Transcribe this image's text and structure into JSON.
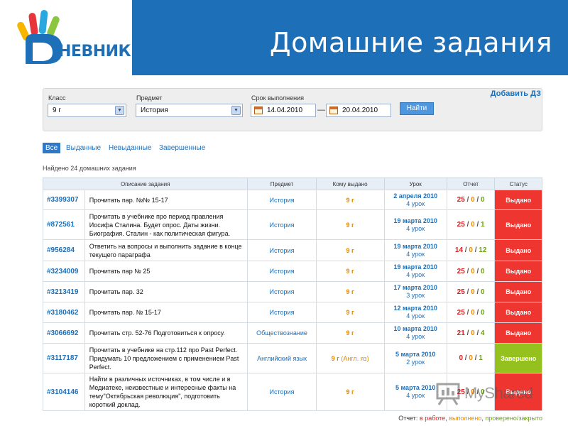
{
  "header": {
    "logo_text": "НЕВНИК",
    "title": "Домашние задания"
  },
  "filter": {
    "class_label": "Класс",
    "class_value": "9 г",
    "subject_label": "Предмет",
    "subject_value": "История",
    "deadline_label": "Срок выполнения",
    "date_from": "14.04.2010",
    "date_to": "20.04.2010",
    "dash": "—",
    "find_button": "Найти",
    "add_link": "Добавить ДЗ"
  },
  "tabs": [
    "Все",
    "Выданные",
    "Невыданные",
    "Завершенные"
  ],
  "found_text": "Найдено 24 домашних задания",
  "table": {
    "headers": [
      "Описание задания",
      "Предмет",
      "Кому выдано",
      "Урок",
      "Отчет",
      "Статус"
    ],
    "rows": [
      {
        "id": "#3399307",
        "desc": "Прочитать пар. №№ 15-17",
        "subject": "История",
        "to": "9 г",
        "to_note": "",
        "date": "2 апреля 2010",
        "lesson": "4 урок",
        "r1": "25",
        "r2": "0",
        "r3": "0",
        "status": "Выдано"
      },
      {
        "id": "#872561",
        "desc": "Прочитать в учебнике про период правления Иосифа Сталина. Будет опрос. Даты жизни. Биография. Сталин - как политическая фигура.",
        "subject": "История",
        "to": "9 г",
        "to_note": "",
        "date": "19 марта 2010",
        "lesson": "4 урок",
        "r1": "25",
        "r2": "0",
        "r3": "1",
        "status": "Выдано"
      },
      {
        "id": "#956284",
        "desc": "Ответить на вопросы и выполнить задание в конце текущего параграфа",
        "subject": "История",
        "to": "9 г",
        "to_note": "",
        "date": "19 марта 2010",
        "lesson": "4 урок",
        "r1": "14",
        "r2": "0",
        "r3": "12",
        "status": "Выдано"
      },
      {
        "id": "#3234009",
        "desc": "Прочитать пар № 25",
        "subject": "История",
        "to": "9 г",
        "to_note": "",
        "date": "19 марта 2010",
        "lesson": "4 урок",
        "r1": "25",
        "r2": "0",
        "r3": "0",
        "status": "Выдано"
      },
      {
        "id": "#3213419",
        "desc": "Прочитать пар. 32",
        "subject": "История",
        "to": "9 г",
        "to_note": "",
        "date": "17 марта 2010",
        "lesson": "3 урок",
        "r1": "25",
        "r2": "0",
        "r3": "0",
        "status": "Выдано"
      },
      {
        "id": "#3180462",
        "desc": "Прочитать пар. № 15-17",
        "subject": "История",
        "to": "9 г",
        "to_note": "",
        "date": "12 марта 2010",
        "lesson": "4 урок",
        "r1": "25",
        "r2": "0",
        "r3": "0",
        "status": "Выдано"
      },
      {
        "id": "#3066692",
        "desc": "Прочитать стр. 52-76 Подготовиться к опросу.",
        "subject": "Обществознание",
        "to": "9 г",
        "to_note": "",
        "date": "10 марта 2010",
        "lesson": "4 урок",
        "r1": "21",
        "r2": "0",
        "r3": "4",
        "status": "Выдано"
      },
      {
        "id": "#3117187",
        "desc": "Прочитать в учебнике на стр.112 про Past Perfect. Придумать 10 предложением с применением Past Perfect.",
        "subject": "Английский язык",
        "to": "9 г",
        "to_note": " (Англ. яз)",
        "date": "5 марта 2010",
        "lesson": "2 урок",
        "r1": "0",
        "r2": "0",
        "r3": "1",
        "status": "Завершено"
      },
      {
        "id": "#3104146",
        "desc": "Найти в различных источниках, в том числе и в Медиатеке, неизвестные и интересные факты на тему\"Октябрьская революция\", подготовить короткий доклад.",
        "subject": "История",
        "to": "9 г",
        "to_note": "",
        "date": "5 марта 2010",
        "lesson": "4 урок",
        "r1": "25",
        "r2": "0",
        "r3": "0",
        "status": "Выдано"
      }
    ]
  },
  "legend": {
    "prefix": "Отчет: ",
    "in_work": "в работе",
    "done": "выполнено",
    "checked": "проверено/закрыто"
  },
  "watermark": "MyShared",
  "colors": {
    "header_blue": "#1d6fb8",
    "issued_red": "#ef3530",
    "done_green": "#95c11f",
    "report_red": "#e02020",
    "report_orange": "#f08c00",
    "report_green": "#6aa50d"
  }
}
